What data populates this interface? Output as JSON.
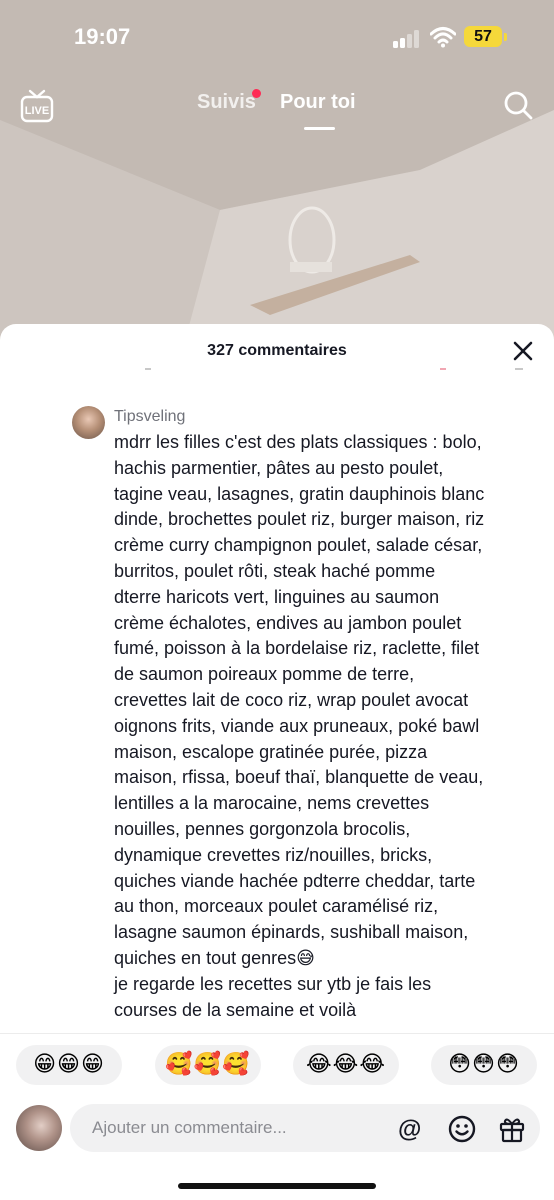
{
  "status_bar": {
    "time": "19:07",
    "battery": "57"
  },
  "top_nav": {
    "tabs": {
      "following": "Suivis",
      "for_you": "Pour toi"
    }
  },
  "icons": {
    "live": "live-tv-icon",
    "search": "search-icon",
    "close": "close-icon",
    "at": "at-mention-icon",
    "emoji": "smile-icon",
    "gift": "gift-icon"
  },
  "comments_panel": {
    "title": "327 commentaires",
    "comment": {
      "username": "Tipsveling",
      "text": "mdrr les filles c'est des plats classiques : bolo,\nhachis parmentier, pâtes au pesto poulet,\ntagine veau, lasagnes, gratin dauphinois blanc\ndinde, brochettes poulet riz, burger maison, riz\ncrème curry champignon poulet, salade césar,\nburritos, poulet rôti, steak haché pomme\ndterre haricots vert, linguines au saumon\ncrème échalotes, endives au jambon poulet\nfumé, poisson à la bordelaise riz, raclette, filet\nde saumon poireaux pomme de terre,\ncrevettes lait de coco riz, wrap poulet avocat\noignons frits, viande aux pruneaux, poké bawl\nmaison, escalope gratinée purée, pizza\nmaison, rfissa, boeuf thaï, blanquette de veau,\nlentilles a la marocaine, nems crevettes\nnouilles, pennes gorgonzola brocolis,\ndynamique crevettes riz/nouilles, bricks,\nquiches viande hachée pdterre cheddar, tarte\nau thon, morceaux poulet caramélisé riz,\nlasagne saumon épinards, sushiball maison,\nquiches en tout genres😅\nje regarde les recettes sur ytb je fais les\ncourses de la semaine et voilà"
    },
    "emoji_reactions": [
      "😁😁😁",
      "🥰🥰🥰",
      "😂😂😂",
      "😳😳😳"
    ],
    "input": {
      "placeholder": "Ajouter un commentaire..."
    }
  },
  "colors": {
    "accent_red": "#fe2c55",
    "battery_yellow": "#f5d83a",
    "text_primary": "#161823",
    "text_secondary": "#6f7179"
  }
}
